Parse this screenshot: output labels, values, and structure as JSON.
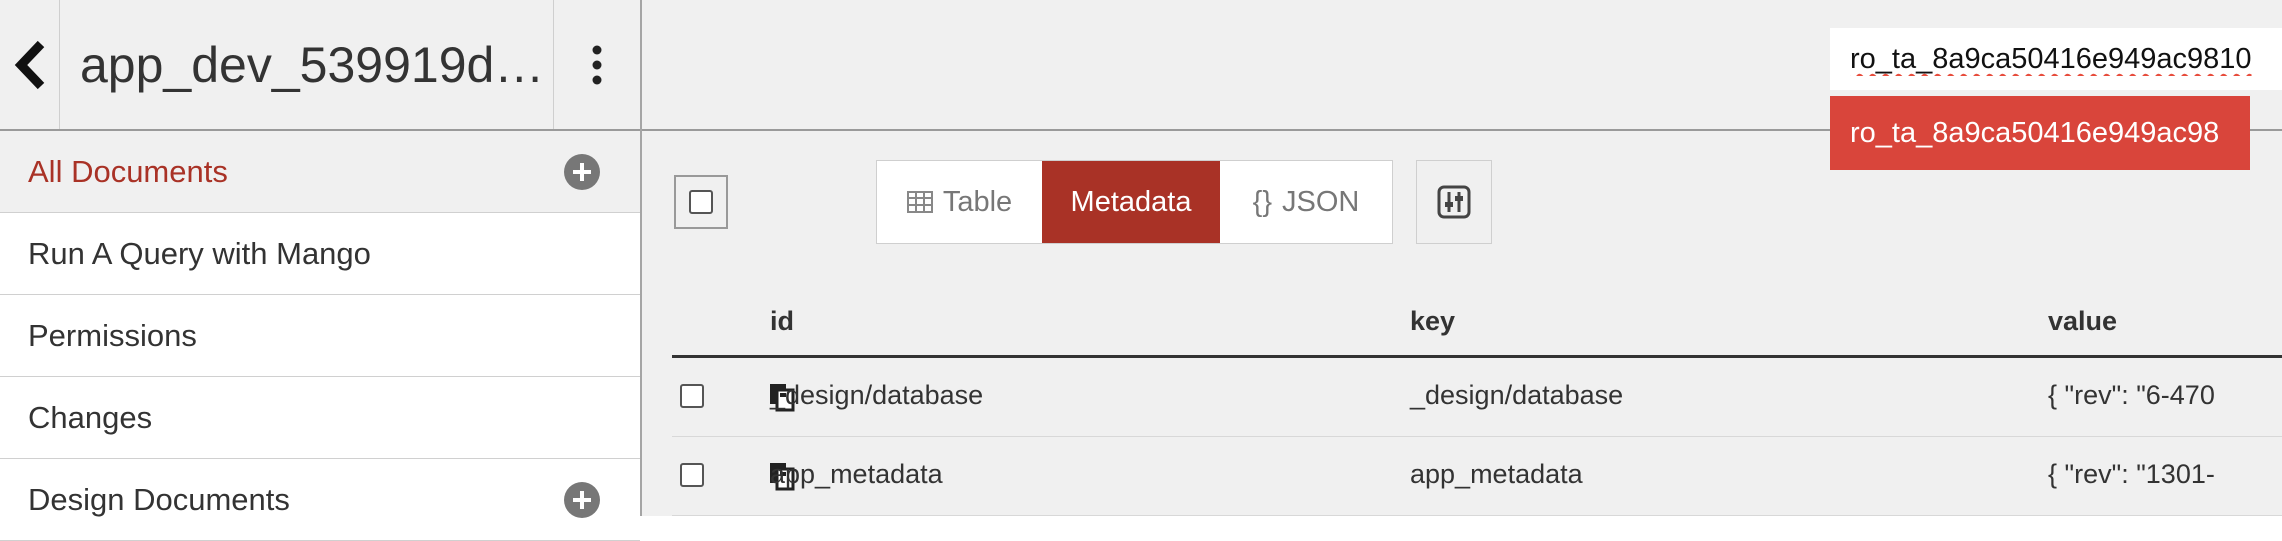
{
  "sidebar": {
    "db_title": "app_dev_539919d…",
    "back_icon": "chevron-left-icon",
    "menu_icon": "kebab-vertical-icon",
    "items": [
      {
        "label": "All Documents",
        "active": true,
        "has_add": true
      },
      {
        "label": "Run A Query with Mango",
        "active": false,
        "has_add": false
      },
      {
        "label": "Permissions",
        "active": false,
        "has_add": false
      },
      {
        "label": "Changes",
        "active": false,
        "has_add": false
      },
      {
        "label": "Design Documents",
        "active": false,
        "has_add": true
      }
    ]
  },
  "search": {
    "value": "ro_ta_8a9ca50416e949ac9810",
    "suggestion": "ro_ta_8a9ca50416e949ac98"
  },
  "toolbar": {
    "views": [
      {
        "label": "Table",
        "icon": "table-icon"
      },
      {
        "label": "Metadata",
        "active": true
      },
      {
        "label": "JSON",
        "icon": "braces-icon",
        "icon_text": "{}"
      }
    ],
    "prefs_icon": "sliders-icon"
  },
  "table": {
    "columns": [
      "id",
      "key",
      "value"
    ],
    "rows": [
      {
        "id": "_design/database",
        "key": "_design/database",
        "value": "{ \"rev\": \"6-470"
      },
      {
        "id": "app_metadata",
        "key": "app_metadata",
        "value": "{ \"rev\": \"1301-"
      }
    ]
  },
  "colors": {
    "accent": "#a93226",
    "suggestion_bg": "#d9453b",
    "panel_bg": "#f0f0f0"
  }
}
